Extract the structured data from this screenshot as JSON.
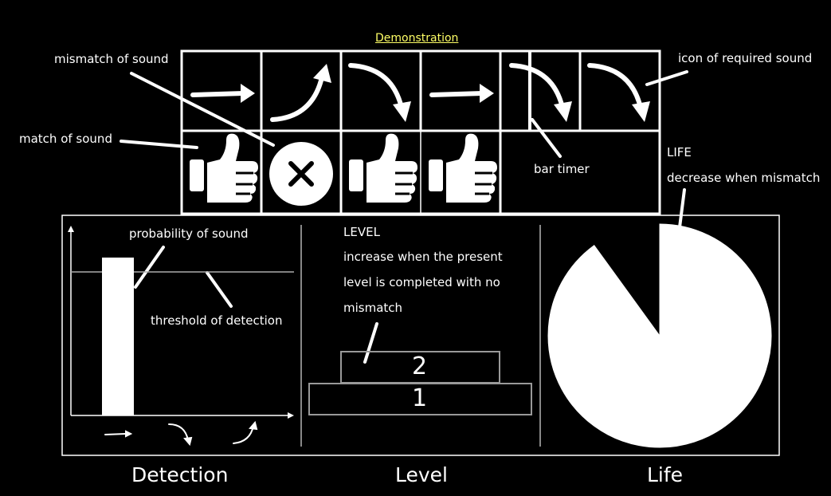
{
  "header": {
    "demonstration_label": "Demonstration"
  },
  "annotations": {
    "mismatch_of_sound": "mismatch of sound",
    "match_of_sound": "match of sound",
    "icon_of_required_sound": "icon of required sound",
    "bar_timer": "bar timer",
    "life_title": "LIFE",
    "life_desc": "decrease when mismatch",
    "probability_of_sound": "probability of sound",
    "threshold_of_detection": "threshold of detection",
    "level_title": "LEVEL",
    "level_desc_lines": [
      "increase when the present",
      "level is completed with no",
      "mismatch"
    ]
  },
  "sequence": {
    "required_icons": [
      "arrow-flat",
      "arrow-up",
      "arrow-down",
      "arrow-flat",
      "arrow-down",
      "arrow-down"
    ],
    "results": [
      "match",
      "mismatch",
      "match",
      "match"
    ]
  },
  "level": {
    "blocks": [
      "1",
      "2"
    ]
  },
  "life": {
    "remaining_fraction": 0.9
  },
  "detection": {
    "threshold_fraction": 0.76,
    "bar_fraction": 0.84
  },
  "panel_titles": {
    "detection": "Detection",
    "level": "Level",
    "life": "Life"
  },
  "colors": {
    "background": "#000000",
    "foreground": "#ffffff",
    "accent": "#ffff66",
    "divider": "#888888"
  }
}
